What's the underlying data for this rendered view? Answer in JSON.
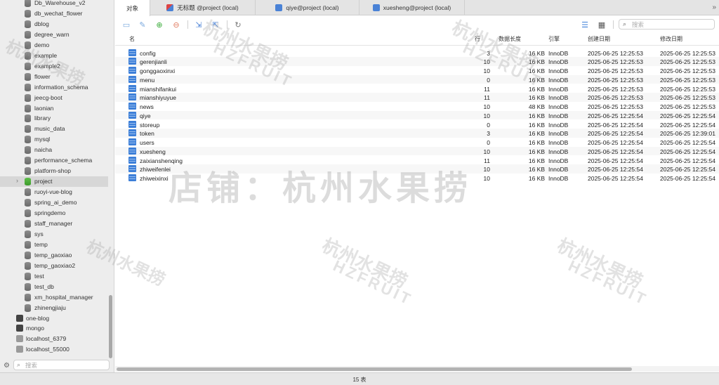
{
  "sidebar": {
    "databases": [
      {
        "label": "Db_Warehouse_v2"
      },
      {
        "label": "db_wechat_flower"
      },
      {
        "label": "dblog"
      },
      {
        "label": "degree_warn"
      },
      {
        "label": "demo"
      },
      {
        "label": "example"
      },
      {
        "label": "example2"
      },
      {
        "label": "flower"
      },
      {
        "label": "information_schema"
      },
      {
        "label": "jeecg-boot"
      },
      {
        "label": "laonian"
      },
      {
        "label": "library"
      },
      {
        "label": "music_data"
      },
      {
        "label": "mysql"
      },
      {
        "label": "naicha"
      },
      {
        "label": "performance_schema"
      },
      {
        "label": "platform-shop"
      },
      {
        "label": "project",
        "selected": true,
        "expanded_indicator": "chevron-right"
      },
      {
        "label": "ruoyi-vue-blog"
      },
      {
        "label": "spring_ai_demo"
      },
      {
        "label": "springdemo"
      },
      {
        "label": "staff_manager"
      },
      {
        "label": "sys"
      },
      {
        "label": "temp"
      },
      {
        "label": "temp_gaoxiao"
      },
      {
        "label": "temp_gaoxiao2"
      },
      {
        "label": "test"
      },
      {
        "label": "test_db"
      },
      {
        "label": "xm_hospital_manager"
      },
      {
        "label": "zhinengjiaju"
      }
    ],
    "connections": [
      {
        "label": "one-blog",
        "icon": "connection-icon"
      },
      {
        "label": "mongo",
        "icon": "mongo-icon"
      },
      {
        "label": "localhost_6379",
        "icon": "redis-icon"
      },
      {
        "label": "localhost_55000",
        "icon": "redis-icon"
      }
    ],
    "search_placeholder": "搜索"
  },
  "tabs": [
    {
      "label": "对象",
      "active": true
    },
    {
      "label": "无标题 @project (local)",
      "icon": "query-icon"
    },
    {
      "label": "qiye@project (local)",
      "icon": "table-icon"
    },
    {
      "label": "xuesheng@project (local)",
      "icon": "table-icon"
    }
  ],
  "toolbar": {
    "search_placeholder": "搜索"
  },
  "table": {
    "headers": {
      "name": "名",
      "rows": "行",
      "data_length": "数据长度",
      "engine": "引擎",
      "created": "创建日期",
      "modified": "修改日期"
    },
    "rows": [
      {
        "name": "config",
        "rows": "3",
        "size": "16 KB",
        "engine": "InnoDB",
        "created": "2025-06-25 12:25:53",
        "modified": "2025-06-25 12:25:53"
      },
      {
        "name": "gerenjianli",
        "rows": "10",
        "size": "16 KB",
        "engine": "InnoDB",
        "created": "2025-06-25 12:25:53",
        "modified": "2025-06-25 12:25:53"
      },
      {
        "name": "gonggaoxinxi",
        "rows": "10",
        "size": "16 KB",
        "engine": "InnoDB",
        "created": "2025-06-25 12:25:53",
        "modified": "2025-06-25 12:25:53"
      },
      {
        "name": "menu",
        "rows": "0",
        "size": "16 KB",
        "engine": "InnoDB",
        "created": "2025-06-25 12:25:53",
        "modified": "2025-06-25 12:25:53"
      },
      {
        "name": "mianshifankui",
        "rows": "11",
        "size": "16 KB",
        "engine": "InnoDB",
        "created": "2025-06-25 12:25:53",
        "modified": "2025-06-25 12:25:53"
      },
      {
        "name": "mianshiyuyue",
        "rows": "11",
        "size": "16 KB",
        "engine": "InnoDB",
        "created": "2025-06-25 12:25:53",
        "modified": "2025-06-25 12:25:53"
      },
      {
        "name": "news",
        "rows": "10",
        "size": "48 KB",
        "engine": "InnoDB",
        "created": "2025-06-25 12:25:53",
        "modified": "2025-06-25 12:25:53"
      },
      {
        "name": "qiye",
        "rows": "10",
        "size": "16 KB",
        "engine": "InnoDB",
        "created": "2025-06-25 12:25:54",
        "modified": "2025-06-25 12:25:54"
      },
      {
        "name": "storeup",
        "rows": "0",
        "size": "16 KB",
        "engine": "InnoDB",
        "created": "2025-06-25 12:25:54",
        "modified": "2025-06-25 12:25:54"
      },
      {
        "name": "token",
        "rows": "3",
        "size": "16 KB",
        "engine": "InnoDB",
        "created": "2025-06-25 12:25:54",
        "modified": "2025-06-25 12:39:01"
      },
      {
        "name": "users",
        "rows": "0",
        "size": "16 KB",
        "engine": "InnoDB",
        "created": "2025-06-25 12:25:54",
        "modified": "2025-06-25 12:25:54"
      },
      {
        "name": "xuesheng",
        "rows": "10",
        "size": "16 KB",
        "engine": "InnoDB",
        "created": "2025-06-25 12:25:54",
        "modified": "2025-06-25 12:25:54"
      },
      {
        "name": "zaixianshenqing",
        "rows": "11",
        "size": "16 KB",
        "engine": "InnoDB",
        "created": "2025-06-25 12:25:54",
        "modified": "2025-06-25 12:25:54"
      },
      {
        "name": "zhiweifenlei",
        "rows": "10",
        "size": "16 KB",
        "engine": "InnoDB",
        "created": "2025-06-25 12:25:54",
        "modified": "2025-06-25 12:25:54"
      },
      {
        "name": "zhiweixinxi",
        "rows": "10",
        "size": "16 KB",
        "engine": "InnoDB",
        "created": "2025-06-25 12:25:54",
        "modified": "2025-06-25 12:25:54"
      }
    ]
  },
  "status": {
    "table_count": "15 表"
  },
  "watermark": {
    "main_text": "店铺：杭州水果捞",
    "small_text": "杭州水果捞",
    "latin_text": "HZFRUIT"
  }
}
